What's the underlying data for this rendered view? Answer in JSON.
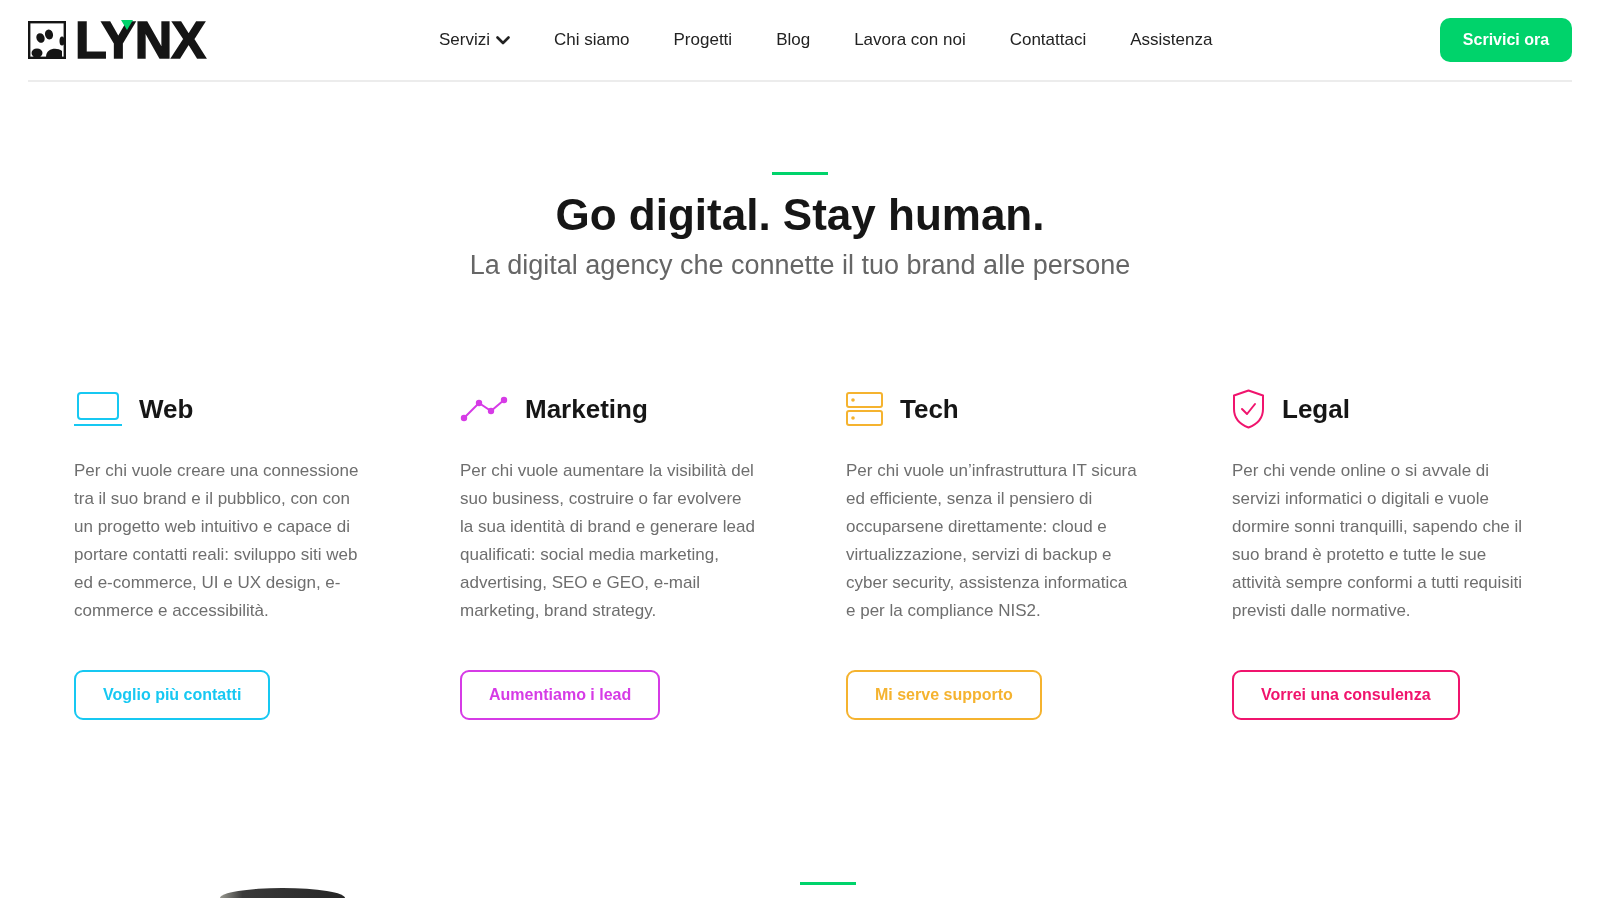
{
  "header": {
    "logo": {
      "text": "LYNX"
    },
    "nav": [
      {
        "label": "Servizi",
        "dropdown": true
      },
      {
        "label": "Chi siamo",
        "dropdown": false
      },
      {
        "label": "Progetti",
        "dropdown": false
      },
      {
        "label": "Blog",
        "dropdown": false
      },
      {
        "label": "Lavora con noi",
        "dropdown": false
      },
      {
        "label": "Contattaci",
        "dropdown": false
      },
      {
        "label": "Assistenza",
        "dropdown": false
      }
    ],
    "cta": "Scrivici ora"
  },
  "hero": {
    "title": "Go digital. Stay human.",
    "subtitle": "La digital agency che connette il tuo brand alle persone"
  },
  "services": [
    {
      "kind": "web",
      "title": "Web",
      "color": "#17c8f2",
      "text": "Per chi vuole creare una connessione tra il suo brand e il pubblico, con con un progetto web intuitivo e capace di portare contatti reali: sviluppo siti web ed e-commerce, UI e UX design, e-commerce e accessibilità.",
      "button": "Voglio più contatti"
    },
    {
      "kind": "marketing",
      "title": "Marketing",
      "color": "#d63be6",
      "text": "Per chi vuole aumentare la visibilità del suo business, costruire o far evolvere la sua identità di brand e generare lead qualificati: social media marketing, advertising, SEO e GEO, e-mail marketing, brand strategy.",
      "button": "Aumentiamo i lead"
    },
    {
      "kind": "tech",
      "title": "Tech",
      "color": "#f5b32f",
      "text": "Per chi vuole un’infrastruttura IT sicura ed efficiente, senza il pensiero di occuparsene direttamente: cloud e virtualizzazione, servizi di backup e cyber security, assistenza informatica e per la compliance NIS2.",
      "button": "Mi serve supporto"
    },
    {
      "kind": "legal",
      "title": "Legal",
      "color": "#f0146d",
      "text": "Per chi vende online o si avvale di servizi informatici o digitali e vuole dormire sonni tranquilli, sapendo che il suo brand è protetto e tutte le sue attività sempre conformi a tutti requisiti previsti dalle normative.",
      "button": "Vorrei una consulenza"
    }
  ]
}
